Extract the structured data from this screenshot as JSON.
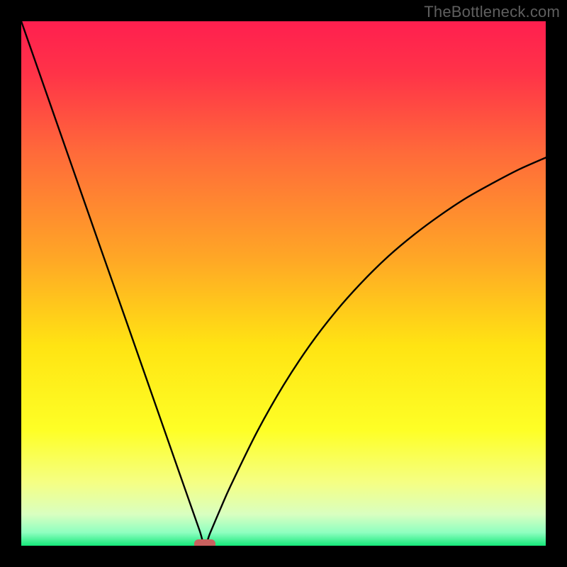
{
  "watermark": "TheBottleneck.com",
  "chart_data": {
    "type": "line",
    "title": "",
    "xlabel": "",
    "ylabel": "",
    "xlim": [
      0,
      100
    ],
    "ylim": [
      0,
      100
    ],
    "x": [
      0,
      5,
      10,
      15,
      20,
      25,
      30,
      32,
      34,
      35,
      36,
      38,
      40,
      45,
      50,
      55,
      60,
      65,
      70,
      75,
      80,
      85,
      90,
      95,
      100
    ],
    "values": [
      100,
      85.7,
      71.4,
      57.1,
      42.9,
      28.6,
      14.3,
      8.6,
      2.9,
      0,
      2.4,
      7.1,
      11.6,
      21.8,
      30.6,
      38.2,
      44.7,
      50.3,
      55.2,
      59.4,
      63.1,
      66.4,
      69.2,
      71.8,
      74.0
    ],
    "marker": {
      "x": 35,
      "y": 0
    },
    "gradient_stops": [
      {
        "offset": 0.0,
        "color": "#ff1f4f"
      },
      {
        "offset": 0.1,
        "color": "#ff3348"
      },
      {
        "offset": 0.25,
        "color": "#ff6a3a"
      },
      {
        "offset": 0.45,
        "color": "#ffa626"
      },
      {
        "offset": 0.62,
        "color": "#ffe413"
      },
      {
        "offset": 0.78,
        "color": "#feff26"
      },
      {
        "offset": 0.88,
        "color": "#f5ff84"
      },
      {
        "offset": 0.94,
        "color": "#d9ffc0"
      },
      {
        "offset": 0.975,
        "color": "#8effc0"
      },
      {
        "offset": 1.0,
        "color": "#15e87a"
      }
    ]
  }
}
